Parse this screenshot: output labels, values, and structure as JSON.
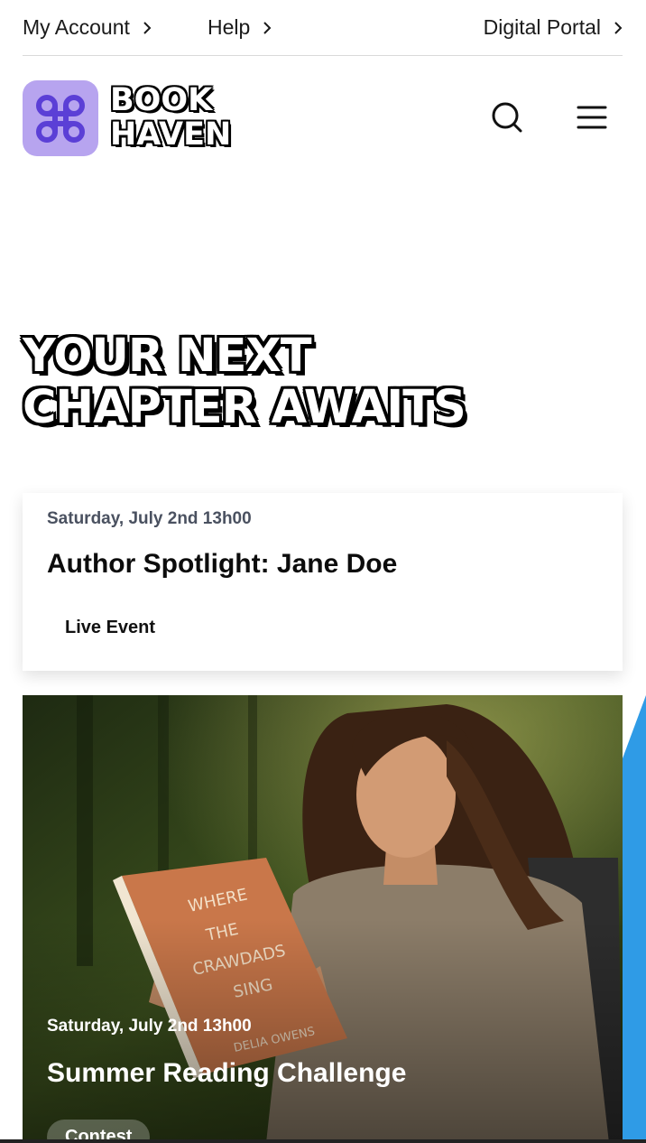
{
  "top_links": {
    "account": "My Account",
    "help": "Help",
    "portal": "Digital Portal"
  },
  "brand": {
    "line1": "BOOK",
    "line2": "HAVEN",
    "logo_color": "#b7a4ef",
    "logo_icon": "command-key-icon"
  },
  "header_icons": {
    "search": "search-icon",
    "menu": "hamburger-menu-icon"
  },
  "hero": {
    "line1": "YOUR NEXT",
    "line2": "CHAPTER AWAITS"
  },
  "events": [
    {
      "date": "Saturday, July 2nd 13h00",
      "title": "Author Spotlight: Jane Doe",
      "badge": "Live Event"
    },
    {
      "date": "Saturday, July 2nd 13h00",
      "title": "Summer Reading Challenge",
      "badge": "Contest",
      "book_title": "WHERE THE CRAWDADS SING",
      "book_author": "DELIA OWENS"
    }
  ],
  "colors": {
    "accent_blue": "#2f9be6",
    "badge_text": "#111111"
  }
}
